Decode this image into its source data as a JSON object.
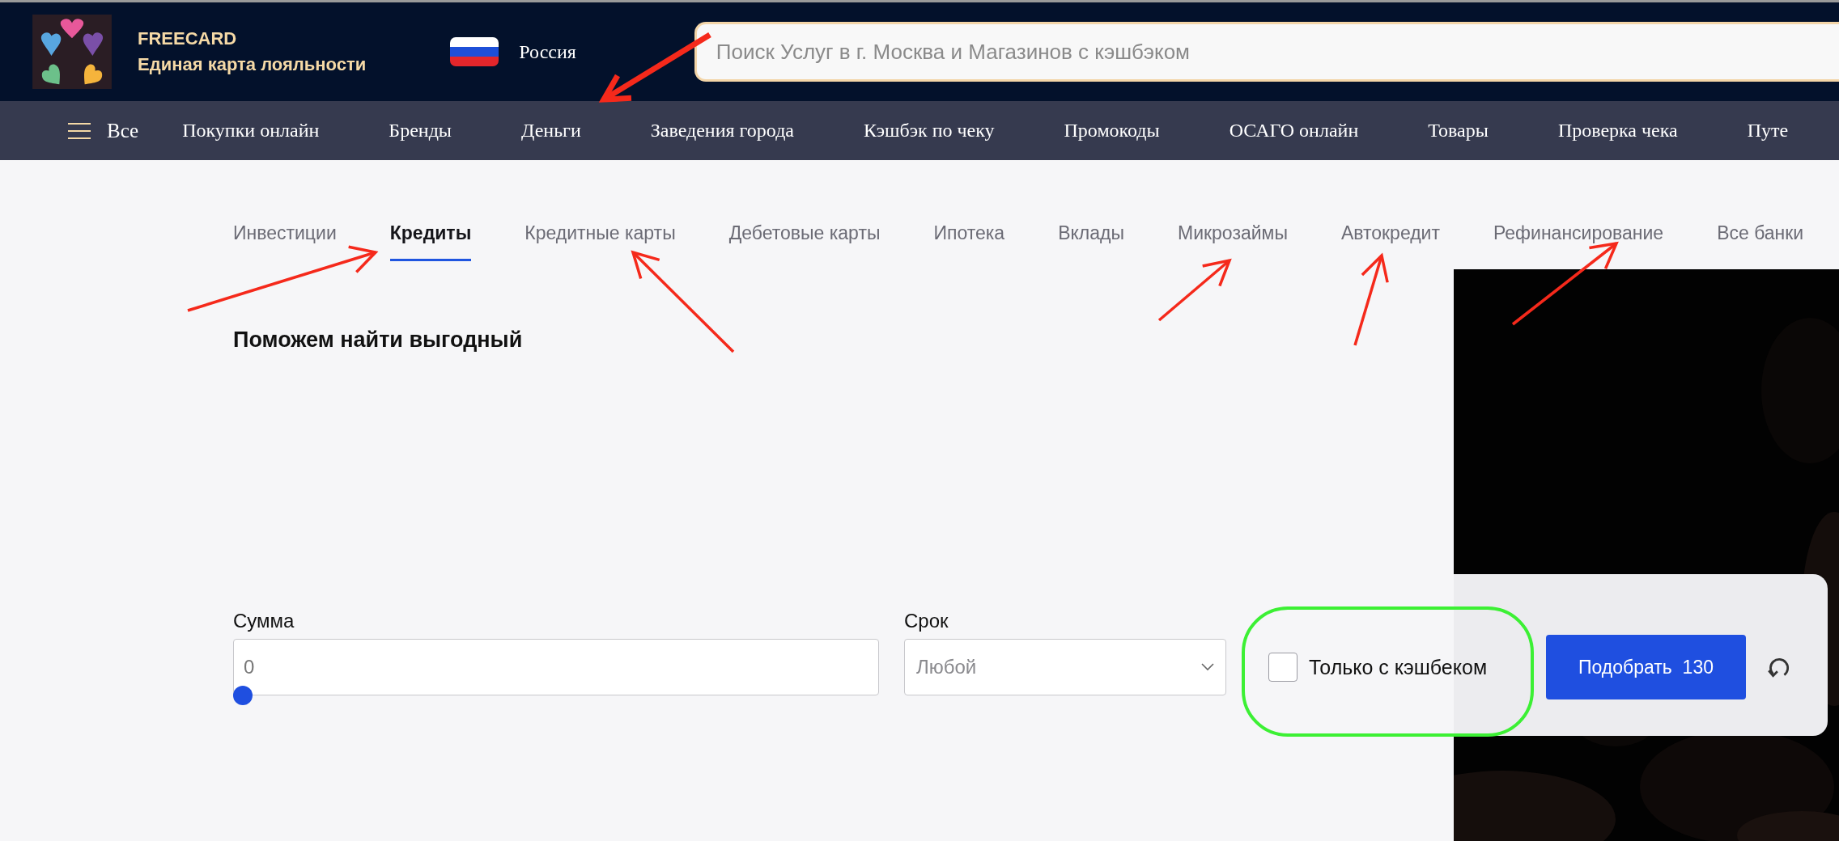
{
  "header": {
    "brand": {
      "name": "FREECARD",
      "tagline": "Единая карта лояльности"
    },
    "region": "Россия",
    "search": {
      "placeholder": "Поиск Услуг в г. Москва и Магазинов с кэшбэком"
    }
  },
  "nav": {
    "menu_label": "Все",
    "items": [
      "Покупки онлайн",
      "Бренды",
      "Деньги",
      "Заведения города",
      "Кэшбэк по чеку",
      "Промокоды",
      "ОСАГО онлайн",
      "Товары",
      "Проверка чека",
      "Путе"
    ]
  },
  "tabs": [
    {
      "label": "Инвестиции",
      "selected": false
    },
    {
      "label": "Кредиты",
      "selected": true
    },
    {
      "label": "Кредитные карты",
      "selected": false
    },
    {
      "label": "Дебетовые карты",
      "selected": false
    },
    {
      "label": "Ипотека",
      "selected": false
    },
    {
      "label": "Вклады",
      "selected": false
    },
    {
      "label": "Микрозаймы",
      "selected": false
    },
    {
      "label": "Автокредит",
      "selected": false
    },
    {
      "label": "Рефинансирование",
      "selected": false
    },
    {
      "label": "Все банки",
      "selected": false
    }
  ],
  "heading": "Поможем найти выгодный",
  "form": {
    "amount": {
      "label": "Сумма",
      "value": "0",
      "level": 0
    },
    "term": {
      "label": "Срок",
      "placeholder": "Любой"
    },
    "cashback_only": {
      "label": "Только с кэшбеком",
      "checked": false
    },
    "submit": {
      "label": "Подобрать",
      "count": "130"
    }
  }
}
